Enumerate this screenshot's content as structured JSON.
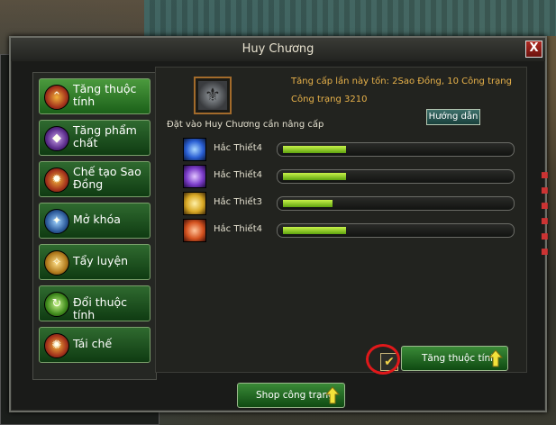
{
  "window": {
    "title": "Huy Chương",
    "close_label": "X"
  },
  "sidebar": {
    "items": [
      {
        "label": "Tăng thuộc tính",
        "icon": "up-arrow-icon",
        "active": true
      },
      {
        "label": "Tăng phẩm chất",
        "icon": "quality-icon",
        "active": false
      },
      {
        "label": "Chế tạo Sao Đồng",
        "icon": "star-craft-icon",
        "active": false
      },
      {
        "label": "Mở khóa",
        "icon": "unlock-icon",
        "active": false
      },
      {
        "label": "Tẩy luyện",
        "icon": "refine-icon",
        "active": false
      },
      {
        "label": "Đổi thuộc tính",
        "icon": "swap-icon",
        "active": false
      },
      {
        "label": "Tái chế",
        "icon": "recycle-icon",
        "active": false
      }
    ]
  },
  "main": {
    "cost_text": "Tăng cấp lần này tốn: 2Sao Đồng, 10 Công trạng",
    "merit_text": "Công trạng 3210",
    "guide_label": "Hướng dẫn",
    "place_hint": "Đặt vào Huy Chương cần nâng cấp",
    "attributes": [
      {
        "name": "Hắc Thiết4",
        "progress": 0.28,
        "icon_color": "#2a5fd4"
      },
      {
        "name": "Hắc Thiết4",
        "progress": 0.28,
        "icon_color": "#7b3cc9"
      },
      {
        "name": "Hắc Thiết3",
        "progress": 0.22,
        "icon_color": "#d9a824"
      },
      {
        "name": "Hắc Thiết4",
        "progress": 0.28,
        "icon_color": "#d4521f"
      }
    ],
    "upgrade_label": "Tăng thuộc tính",
    "shop_label": "Shop công trạng"
  },
  "colors": {
    "accent_green": "#3a8a37",
    "highlight_red": "#e0181a",
    "gold_text": "#e8b24a"
  }
}
